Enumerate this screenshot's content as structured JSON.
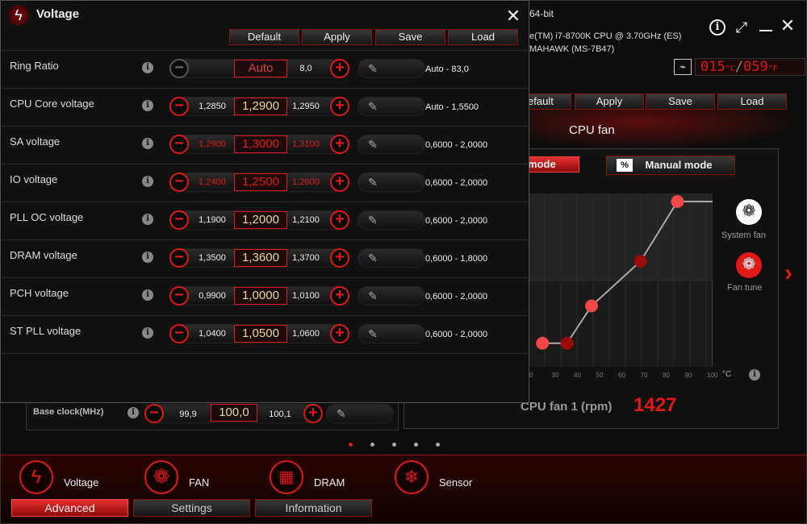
{
  "bg": {
    "os": "64-bit",
    "cpu": "e(TM) i7-8700K CPU @ 3.70GHz (ES)",
    "board": "MAHAWK (MS-7B47)",
    "temp_c": "015",
    "temp_c_unit": "°C",
    "temp_f": "059",
    "temp_f_unit": "°F",
    "buttons": [
      "efault",
      "Apply",
      "Save",
      "Load"
    ],
    "fan_title": "CPU fan",
    "mode_left": "mode",
    "mode_right_icon": "%",
    "mode_right": "Manual mode",
    "system_fan": "System fan",
    "fan_tune": "Fan tune",
    "degree_unit": "°C",
    "x_ticks": [
      "0",
      "30",
      "40",
      "50",
      "60",
      "70",
      "80",
      "90",
      "100"
    ],
    "rpm_label": "CPU fan 1 (rpm)",
    "rpm_value": "1427",
    "base_clock": {
      "label": "Base clock(MHz)",
      "low": "99,9",
      "value": "100,0",
      "high": "100,1"
    }
  },
  "fan_curve": [
    {
      "temp": 30,
      "pct": 5
    },
    {
      "temp": 40,
      "pct": 5
    },
    {
      "temp": 50,
      "pct": 30
    },
    {
      "temp": 70,
      "pct": 60
    },
    {
      "temp": 85,
      "pct": 100
    },
    {
      "temp": 100,
      "pct": 100
    }
  ],
  "voltage": {
    "title": "Voltage",
    "buttons": [
      "Default",
      "Apply",
      "Save",
      "Load"
    ],
    "rows": [
      {
        "label": "Ring Ratio",
        "low": "",
        "value": "Auto",
        "high": "8,0",
        "range": "Auto - 83,0",
        "warn": false
      },
      {
        "label": "CPU Core voltage",
        "low": "1,2850",
        "value": "1,2900",
        "high": "1,2950",
        "range": "Auto - 1,5500",
        "warn": false
      },
      {
        "label": "SA voltage",
        "low": "1,2900",
        "value": "1,3000",
        "high": "1,3100",
        "range": "0,6000 - 2,0000",
        "warn": true
      },
      {
        "label": "IO voltage",
        "low": "1,2400",
        "value": "1,2500",
        "high": "1,2600",
        "range": "0,6000 - 2,0000",
        "warn": true
      },
      {
        "label": "PLL OC voltage",
        "low": "1,1900",
        "value": "1,2000",
        "high": "1,2100",
        "range": "0,6000 - 2,0000",
        "warn": false
      },
      {
        "label": "DRAM voltage",
        "low": "1,3500",
        "value": "1,3600",
        "high": "1,3700",
        "range": "0,6000 - 1,8000",
        "warn": false
      },
      {
        "label": "PCH voltage",
        "low": "0,9900",
        "value": "1,0000",
        "high": "1,0100",
        "range": "0,6000 - 2,0000",
        "warn": false
      },
      {
        "label": "ST PLL voltage",
        "low": "1,0400",
        "value": "1,0500",
        "high": "1,0600",
        "range": "0,6000 - 2,0000",
        "warn": false
      }
    ]
  },
  "nav": {
    "items": [
      "Voltage",
      "FAN",
      "DRAM",
      "Sensor"
    ],
    "tabs": [
      "Advanced",
      "Settings",
      "Information"
    ],
    "active_tab": 0
  }
}
